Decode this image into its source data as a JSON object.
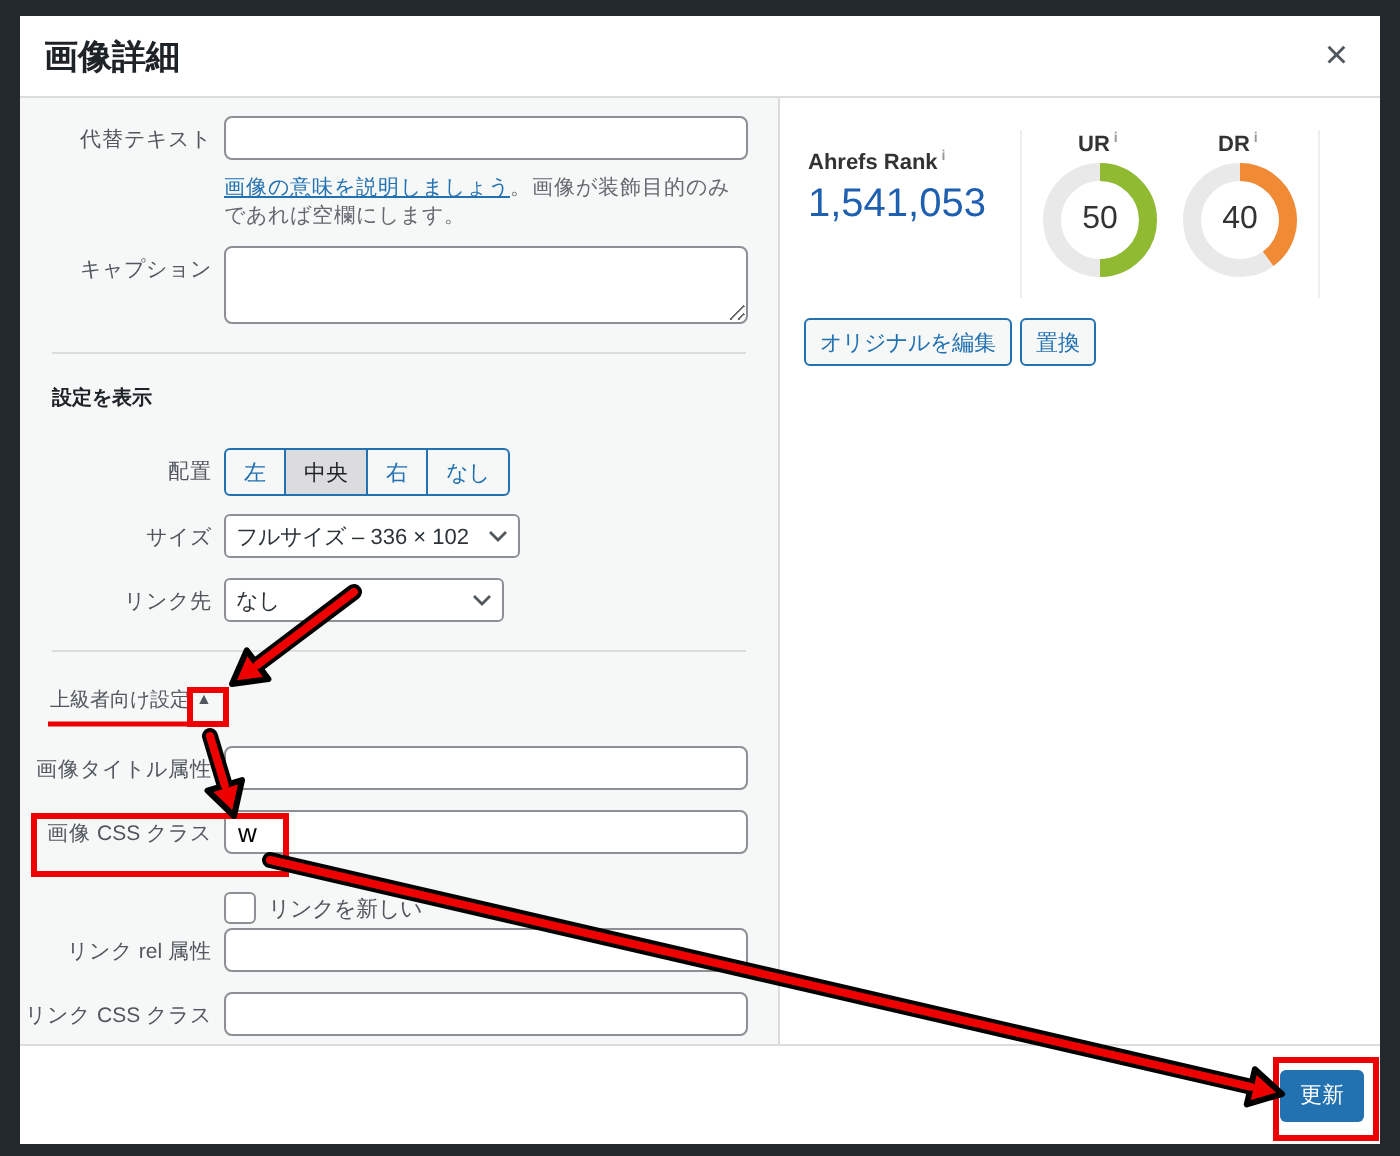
{
  "dialog": {
    "title": "画像詳細",
    "close": "×"
  },
  "fields_top": [
    {
      "label": "代替テキスト",
      "kind": "input"
    }
  ],
  "help": {
    "link": "画像の意味を説明しましょう",
    "text": "。画像が装飾目的のみであれば空欄にします。"
  },
  "caption": {
    "label": "キャプション"
  },
  "display_settings": {
    "heading": "設定を表示",
    "align": {
      "label": "配置",
      "options": [
        {
          "label": "左",
          "selected": false
        },
        {
          "label": "中央",
          "selected": true
        },
        {
          "label": "右",
          "selected": false
        },
        {
          "label": "なし",
          "selected": false
        }
      ]
    },
    "size": {
      "label": "サイズ",
      "value": "フルサイズ – 336 × 102"
    },
    "link": {
      "label": "リンク先",
      "value": "なし"
    }
  },
  "advanced": {
    "heading": "上級者向け設定",
    "toggle": "▲",
    "fields": [
      {
        "kind": "input",
        "label": "画像タイトル属性"
      },
      {
        "kind": "input",
        "label": "画像 CSS クラス",
        "value": "w"
      },
      {
        "kind": "checkbox",
        "label": "リンクを新しい",
        "checked": false
      },
      {
        "kind": "input",
        "label": "リンク rel 属性"
      },
      {
        "kind": "input",
        "label": "リンク CSS クラス"
      }
    ]
  },
  "ahrefs": {
    "rank_label": "Ahrefs Rank",
    "rank_value": "1,541,053",
    "info": "i",
    "gauges": [
      {
        "label": "UR",
        "info": "i",
        "value": "50",
        "level": 0.5,
        "color": "#8fba31"
      },
      {
        "label": "DR",
        "info": "i",
        "value": "40",
        "level": 0.4,
        "color": "#f08a35"
      }
    ]
  },
  "actions": [
    "オリジナルを編集",
    "置換"
  ],
  "footer": {
    "button": "更新"
  }
}
